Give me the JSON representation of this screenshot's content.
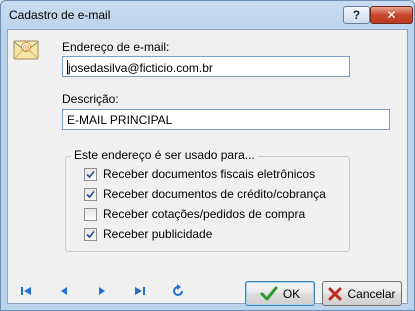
{
  "window": {
    "title": "Cadastro de e-mail",
    "help_label": "?",
    "close_label": "✕"
  },
  "form": {
    "email_label": "Endereço de e-mail:",
    "email_value": "josedasilva@ficticio.com.br",
    "description_label": "Descrição:",
    "description_value": "E-MAIL PRINCIPAL"
  },
  "usage_group": {
    "title": "Este endereço é ser usado para...",
    "options": [
      {
        "label": "Receber documentos fiscais eletrônicos",
        "checked": true
      },
      {
        "label": "Receber documentos de crédito/cobrança",
        "checked": true
      },
      {
        "label": "Receber cotações/pedidos de compra",
        "checked": false
      },
      {
        "label": "Receber publicidade",
        "checked": true
      }
    ]
  },
  "navigation": {
    "icons": [
      "first-record-icon",
      "previous-record-icon",
      "next-record-icon",
      "last-record-icon",
      "refresh-icon"
    ]
  },
  "buttons": {
    "ok_label": "OK",
    "cancel_label": "Cancelar"
  },
  "colors": {
    "nav_blue": "#1f6fd0",
    "ok_green": "#2e9a2e",
    "cancel_red": "#c0281e",
    "titlebar": "#c9dcf0"
  }
}
